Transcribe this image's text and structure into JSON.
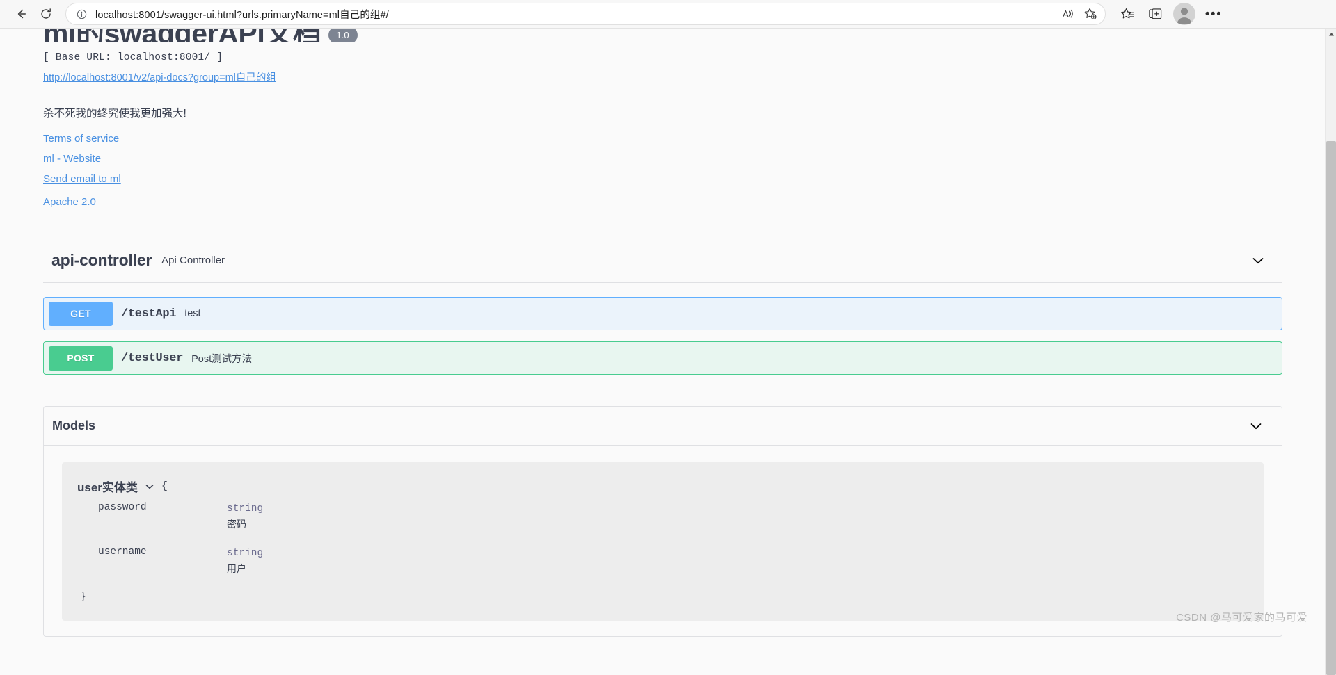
{
  "browser": {
    "back_label": "Back",
    "refresh_label": "Refresh",
    "url_display": "localhost:8001/swagger-ui.html?urls.primaryName=ml自己的组#/",
    "url_host": "localhost:8001",
    "url_path": "/swagger-ui.html?urls.primaryName=ml自己的组#/",
    "site_info_label": "View site information",
    "read_aloud_label": "Read this page aloud",
    "add_favorite_label": "Add this page to favorites",
    "favorites_label": "Favorites",
    "collections_label": "Collections",
    "profile_label": "Profile",
    "settings_label": "Settings and more"
  },
  "swagger": {
    "title": "ml的swaggerAPI文档",
    "version_badge": "1.0",
    "base_url": "[ Base URL: localhost:8001/ ]",
    "docs_link": "http://localhost:8001/v2/api-docs?group=ml自己的组",
    "description": "杀不死我的终究使我更加强大!",
    "links": [
      {
        "label": "Terms of service",
        "name": "terms-of-service-link"
      },
      {
        "label": "ml - Website",
        "name": "contact-website-link"
      },
      {
        "label": "Send email to ml",
        "name": "contact-email-link"
      },
      {
        "label": "Apache 2.0",
        "name": "license-link"
      }
    ]
  },
  "tag": {
    "name": "api-controller",
    "description": "Api Controller",
    "collapse_label": "Collapse operations"
  },
  "operations": [
    {
      "method": "GET",
      "path": "/testApi",
      "summary": "test",
      "style": "get"
    },
    {
      "method": "POST",
      "path": "/testUser",
      "summary": "Post测试方法",
      "style": "post"
    }
  ],
  "models": {
    "title": "Models",
    "collapse_label": "Collapse models",
    "schemas": [
      {
        "name": "user实体类",
        "brace_open": "{",
        "brace_close": "}",
        "properties": [
          {
            "name": "password",
            "type": "string",
            "description": "密码"
          },
          {
            "name": "username",
            "type": "string",
            "description": "用户"
          }
        ]
      }
    ]
  },
  "watermark": "CSDN @马可爱家的马可爱",
  "colors": {
    "get": "#61affe",
    "post": "#49cc90",
    "link": "#4990e2",
    "text": "#3b4151"
  }
}
